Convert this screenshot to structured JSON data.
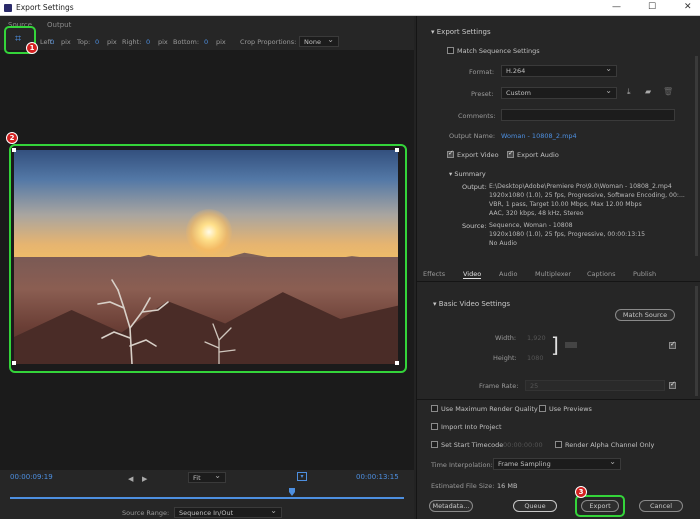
{
  "window": {
    "title": "Export Settings",
    "minimize": "—",
    "maximize": "☐",
    "close": "✕"
  },
  "left": {
    "tabs": [
      "Source",
      "Output"
    ],
    "crop": {
      "left_label": "Left:",
      "left_val": "0",
      "top_label": "Top:",
      "top_val": "0",
      "right_label": "Right:",
      "right_val": "0",
      "bottom_label": "Bottom:",
      "bottom_val": "0",
      "unit": "pix",
      "proportions_label": "Crop Proportions:",
      "proportions_val": "None"
    },
    "badges": [
      "1",
      "2"
    ],
    "timecode_left": "00:00:09:19",
    "timecode_right": "00:00:13:15",
    "fit": "Fit",
    "source_range_label": "Source Range:",
    "source_range_val": "Sequence In/Out"
  },
  "export_settings": {
    "title": "Export Settings",
    "match_sequence": "Match Sequence Settings",
    "format_label": "Format:",
    "format_val": "H.264",
    "preset_label": "Preset:",
    "preset_val": "Custom",
    "comments_label": "Comments:",
    "output_name_label": "Output Name:",
    "output_name_val": "Woman - 10808_2.mp4",
    "export_video": "Export Video",
    "export_audio": "Export Audio",
    "summary_title": "Summary",
    "output_label": "Output:",
    "output_lines": [
      "E:\\Desktop\\Adobe\\Premiere Pro\\9.0\\Woman - 10808_2.mp4",
      "1920x1080 (1.0), 25 fps, Progressive, Software Encoding, 00:...",
      "VBR, 1 pass, Target 10.00 Mbps, Max 12.00 Mbps",
      "AAC, 320 kbps, 48 kHz, Stereo"
    ],
    "source_label": "Source:",
    "source_lines": [
      "Sequence, Woman - 10808",
      "1920x1080 (1.0), 25 fps, Progressive, 00:00:13:15",
      "No Audio"
    ]
  },
  "tabs": [
    "Effects",
    "Video",
    "Audio",
    "Multiplexer",
    "Captions",
    "Publish"
  ],
  "video": {
    "title": "Basic Video Settings",
    "match_source": "Match Source",
    "width_label": "Width:",
    "width_val": "1,920",
    "height_label": "Height:",
    "height_val": "1080",
    "frame_rate_label": "Frame Rate:",
    "frame_rate_val": "25"
  },
  "bottom": {
    "max_render": "Use Maximum Render Quality",
    "use_previews": "Use Previews",
    "import_project": "Import Into Project",
    "set_start": "Set Start Timecode",
    "start_tc": "00:00:00:00",
    "render_alpha": "Render Alpha Channel Only",
    "interp_label": "Time Interpolation:",
    "interp_val": "Frame Sampling",
    "file_size_label": "Estimated File Size:",
    "file_size_val": "16 MB",
    "metadata": "Metadata...",
    "queue": "Queue",
    "export": "Export",
    "cancel": "Cancel",
    "badge3": "3"
  },
  "colors": {
    "accent": "#4d8fe0",
    "highlight": "#34d43a",
    "badge": "#d32020"
  }
}
